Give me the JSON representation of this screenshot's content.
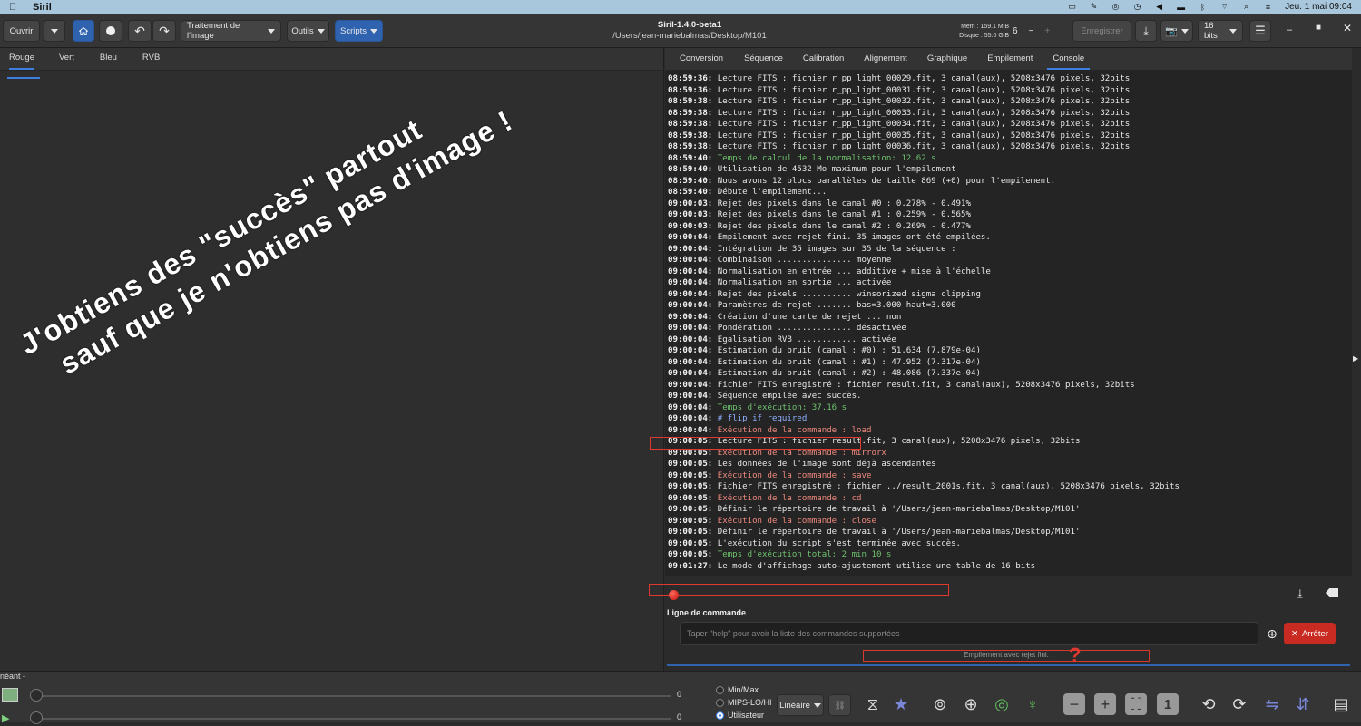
{
  "menubar": {
    "app_name": "Siril",
    "datetime": "Jeu. 1 mai  09:04"
  },
  "header": {
    "open_label": "Ouvrir",
    "image_processing_label": "Traitement de l'image",
    "tools_label": "Outils",
    "scripts_label": "Scripts",
    "window_title": "Siril-1.4.0-beta1",
    "window_path": "/Users/jean-mariebalmas/Desktop/M101",
    "mem": "Mem : 159.1 MiB",
    "disk": "Disque : 55.0 GiB",
    "threads": "6",
    "save_label": "Enregistrer",
    "bits_label": "16 bits"
  },
  "channel_tabs": [
    "Rouge",
    "Vert",
    "Bleu",
    "RVB"
  ],
  "overlay": {
    "line1": "J'obtiens des \"succès\" partout",
    "line2": "sauf que je n'obtiens pas d'image !"
  },
  "page_tabs": [
    "Conversion",
    "Séquence",
    "Calibration",
    "Alignement",
    "Graphique",
    "Empilement",
    "Console"
  ],
  "console_lines": [
    {
      "ts": "08:59:36:",
      "msg": " Lecture FITS : fichier r_pp_light_00029.fit, 3 canal(aux), 5208x3476 pixels, 32bits",
      "c": ""
    },
    {
      "ts": "08:59:36:",
      "msg": " Lecture FITS : fichier r_pp_light_00031.fit, 3 canal(aux), 5208x3476 pixels, 32bits",
      "c": ""
    },
    {
      "ts": "08:59:38:",
      "msg": " Lecture FITS : fichier r_pp_light_00032.fit, 3 canal(aux), 5208x3476 pixels, 32bits",
      "c": ""
    },
    {
      "ts": "08:59:38:",
      "msg": " Lecture FITS : fichier r_pp_light_00033.fit, 3 canal(aux), 5208x3476 pixels, 32bits",
      "c": ""
    },
    {
      "ts": "08:59:38:",
      "msg": " Lecture FITS : fichier r_pp_light_00034.fit, 3 canal(aux), 5208x3476 pixels, 32bits",
      "c": ""
    },
    {
      "ts": "08:59:38:",
      "msg": " Lecture FITS : fichier r_pp_light_00035.fit, 3 canal(aux), 5208x3476 pixels, 32bits",
      "c": ""
    },
    {
      "ts": "08:59:38:",
      "msg": " Lecture FITS : fichier r_pp_light_00036.fit, 3 canal(aux), 5208x3476 pixels, 32bits",
      "c": ""
    },
    {
      "ts": "08:59:40:",
      "msg": " Temps de calcul de la normalisation: 12.62 s",
      "c": "green"
    },
    {
      "ts": "08:59:40:",
      "msg": " Utilisation de 4532 Mo maximum pour l'empilement",
      "c": ""
    },
    {
      "ts": "08:59:40:",
      "msg": " Nous avons 12 blocs parallèles de taille 869 (+0) pour l'empilement.",
      "c": ""
    },
    {
      "ts": "08:59:40:",
      "msg": " Débute l'empilement...",
      "c": ""
    },
    {
      "ts": "09:00:03:",
      "msg": " Rejet des pixels dans le canal #0 : 0.278% - 0.491%",
      "c": ""
    },
    {
      "ts": "09:00:03:",
      "msg": " Rejet des pixels dans le canal #1 : 0.259% - 0.565%",
      "c": ""
    },
    {
      "ts": "09:00:03:",
      "msg": " Rejet des pixels dans le canal #2 : 0.269% - 0.477%",
      "c": ""
    },
    {
      "ts": "09:00:04:",
      "msg": " Empilement avec rejet fini. 35 images ont été empilées.",
      "c": ""
    },
    {
      "ts": "09:00:04:",
      "msg": " Intégration de 35 images sur 35 de la séquence :",
      "c": ""
    },
    {
      "ts": "09:00:04:",
      "msg": " Combinaison ............... moyenne",
      "c": ""
    },
    {
      "ts": "09:00:04:",
      "msg": " Normalisation en entrée ... additive + mise à l'échelle",
      "c": ""
    },
    {
      "ts": "09:00:04:",
      "msg": " Normalisation en sortie ... activée",
      "c": ""
    },
    {
      "ts": "09:00:04:",
      "msg": " Rejet des pixels .......... winsorized sigma clipping",
      "c": ""
    },
    {
      "ts": "09:00:04:",
      "msg": " Paramètres de rejet ....... bas=3.000 haut=3.000",
      "c": ""
    },
    {
      "ts": "09:00:04:",
      "msg": " Création d'une carte de rejet ... non",
      "c": ""
    },
    {
      "ts": "09:00:04:",
      "msg": " Pondération ............... désactivée",
      "c": ""
    },
    {
      "ts": "09:00:04:",
      "msg": " Égalisation RVB ............ activée",
      "c": ""
    },
    {
      "ts": "09:00:04:",
      "msg": " Estimation du bruit (canal : #0) : 51.634 (7.879e-04)",
      "c": ""
    },
    {
      "ts": "09:00:04:",
      "msg": " Estimation du bruit (canal : #1) : 47.952 (7.317e-04)",
      "c": ""
    },
    {
      "ts": "09:00:04:",
      "msg": " Estimation du bruit (canal : #2) : 48.086 (7.337e-04)",
      "c": ""
    },
    {
      "ts": "09:00:04:",
      "msg": " Fichier FITS enregistré : fichier result.fit, 3 canal(aux), 5208x3476 pixels, 32bits",
      "c": ""
    },
    {
      "ts": "09:00:04:",
      "msg": " Séquence empilée avec succès.",
      "c": ""
    },
    {
      "ts": "09:00:04:",
      "msg": " Temps d'exécution: 37.16 s",
      "c": "green"
    },
    {
      "ts": "09:00:04:",
      "msg": " # flip if required",
      "c": "blue"
    },
    {
      "ts": "09:00:04:",
      "msg": " Exécution de la commande : load",
      "c": "red"
    },
    {
      "ts": "09:00:05:",
      "msg": " Lecture FITS : fichier result.fit, 3 canal(aux), 5208x3476 pixels, 32bits",
      "c": ""
    },
    {
      "ts": "09:00:05:",
      "msg": " Exécution de la commande : mirrorx",
      "c": "red"
    },
    {
      "ts": "09:00:05:",
      "msg": " Les données de l'image sont déjà ascendantes",
      "c": ""
    },
    {
      "ts": "09:00:05:",
      "msg": " Exécution de la commande : save",
      "c": "red"
    },
    {
      "ts": "09:00:05:",
      "msg": " Fichier FITS enregistré : fichier ../result_2001s.fit, 3 canal(aux), 5208x3476 pixels, 32bits",
      "c": ""
    },
    {
      "ts": "09:00:05:",
      "msg": " Exécution de la commande : cd",
      "c": "red"
    },
    {
      "ts": "09:00:05:",
      "msg": " Définir le répertoire de travail à '/Users/jean-mariebalmas/Desktop/M101'",
      "c": ""
    },
    {
      "ts": "09:00:05:",
      "msg": " Exécution de la commande : close",
      "c": "red"
    },
    {
      "ts": "09:00:05:",
      "msg": " Définir le répertoire de travail à '/Users/jean-mariebalmas/Desktop/M101'",
      "c": ""
    },
    {
      "ts": "09:00:05:",
      "msg": " L'exécution du script s'est terminée avec succès.",
      "c": ""
    },
    {
      "ts": "09:00:05:",
      "msg": " Temps d'exécution total: 2 min 10 s",
      "c": "green"
    },
    {
      "ts": "09:01:27:",
      "msg": " Le mode d'affichage auto-ajustement utilise une table de 16 bits",
      "c": ""
    }
  ],
  "command": {
    "label": "Ligne de commande",
    "placeholder": "Taper \"help\" pour avoir la liste des commandes supportées",
    "stop_label": "Arrêter",
    "status_text": "Empilement avec rejet fini.",
    "question_mark": "?"
  },
  "bottom": {
    "layer_label": "néant -",
    "slider_high_value": "0",
    "slider_low_value": "0",
    "radio_options": [
      "Min/Max",
      "MIPS-LO/HI",
      "Utilisateur"
    ],
    "selected_radio": "Utilisateur",
    "stretch_mode": "Linéaire",
    "one_label": "1"
  }
}
